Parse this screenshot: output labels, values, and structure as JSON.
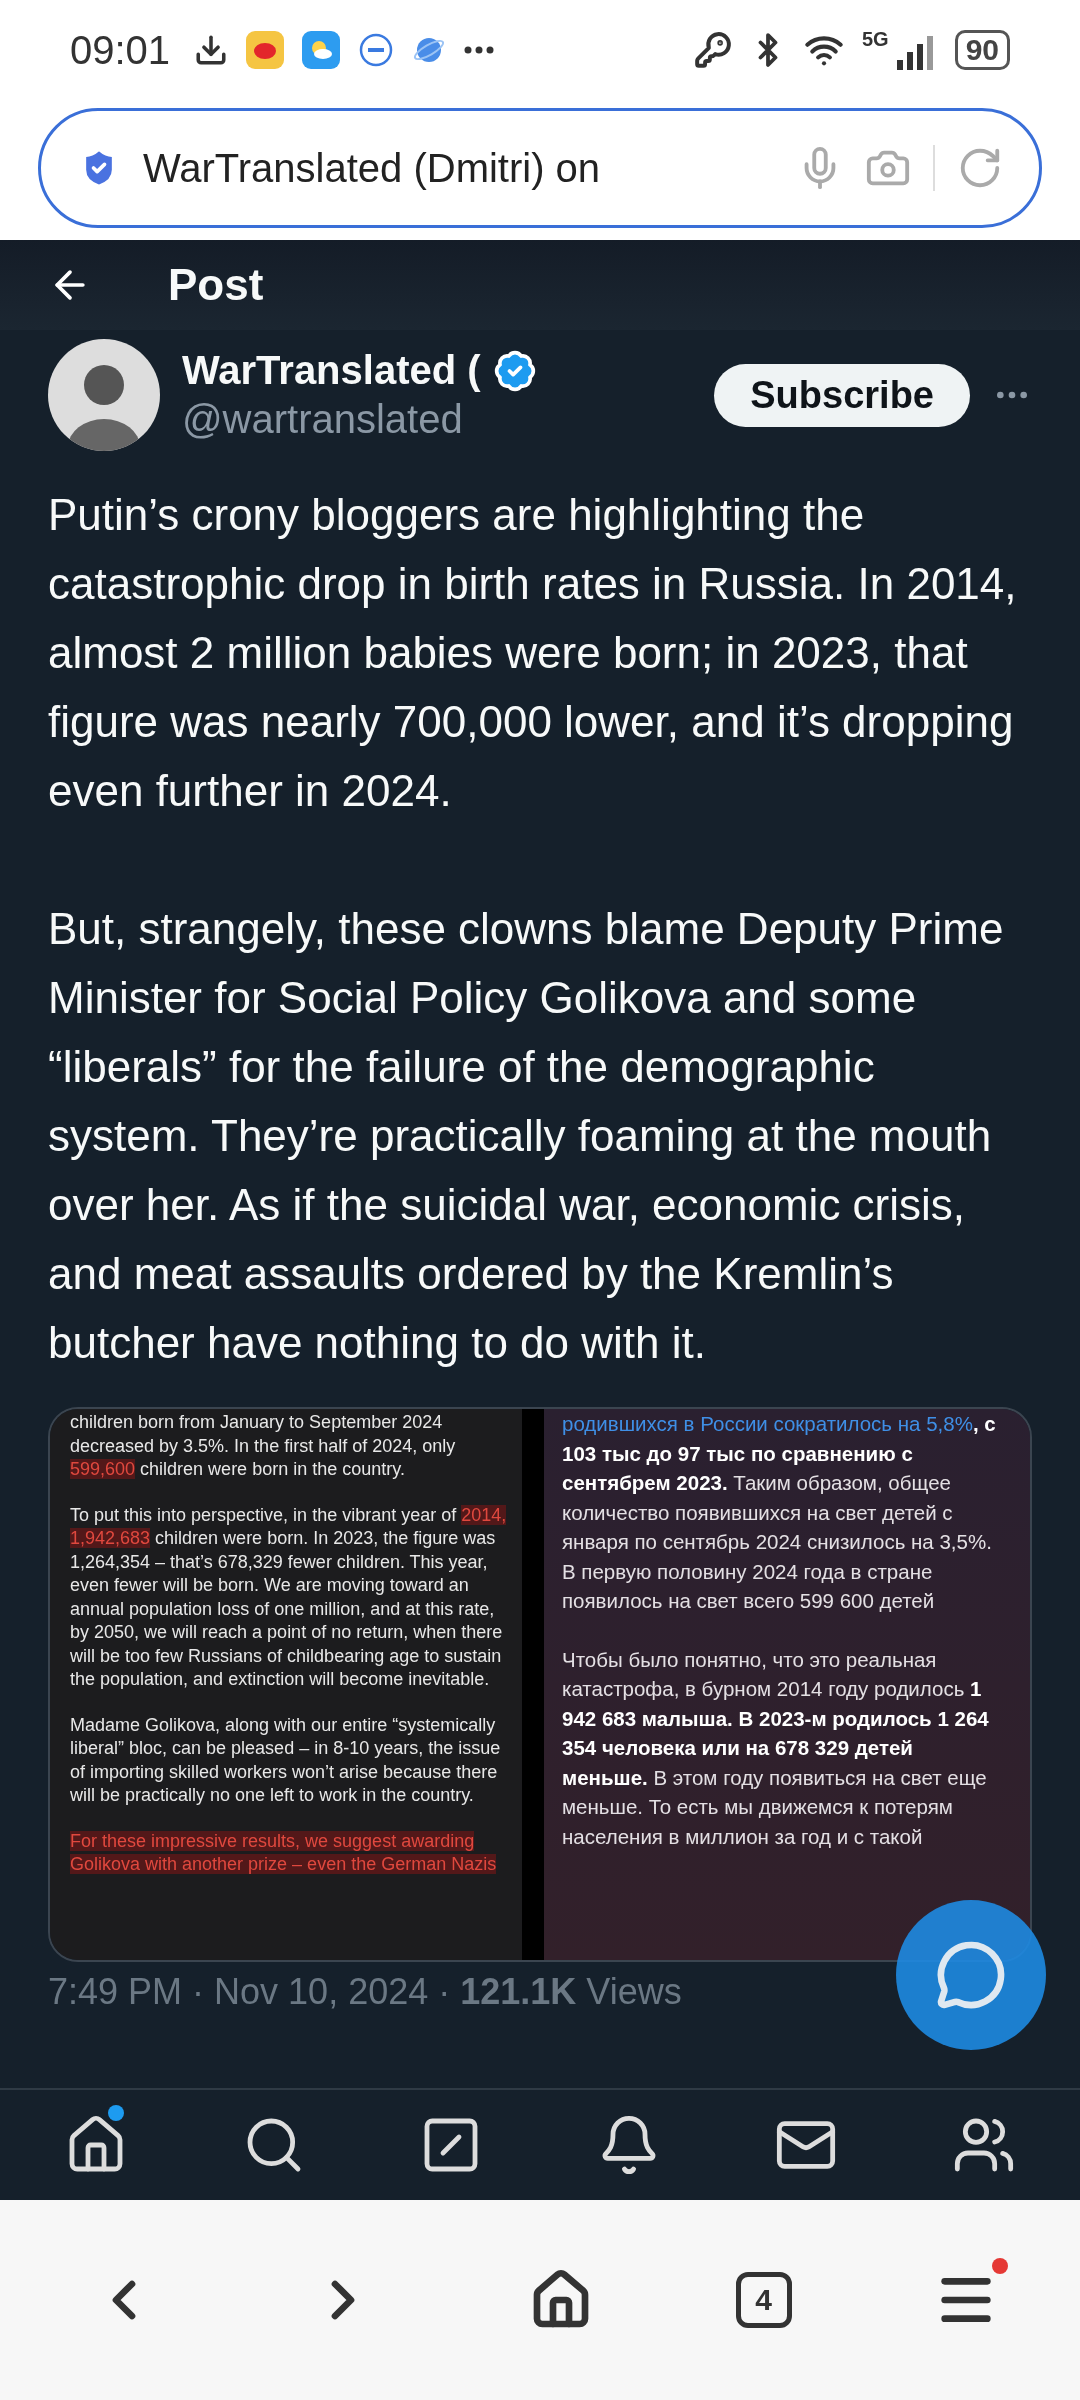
{
  "status_bar": {
    "time": "09:01",
    "network": "5G",
    "battery": "90"
  },
  "address_bar": {
    "value": "WarTranslated (Dmitri) on"
  },
  "header": {
    "title": "Post"
  },
  "author": {
    "name": "WarTranslated (",
    "handle": "@wartranslated",
    "verified": true,
    "subscribe_label": "Subscribe"
  },
  "post": {
    "paragraphs": [
      "Putin’s crony bloggers are highlighting the catastrophic drop in birth rates in Russia. In 2014, almost 2 million babies were born; in 2023, that figure was nearly 700,000 lower, and it’s dropping even further in 2024.",
      "But, strangely, these clowns blame Deputy Prime Minister for Social Policy Golikova and some “liberals” for the failure of the demographic system. They’re practically foaming at the mouth over her. As if the suicidal war, economic crisis, and meat assaults ordered by the Kremlin’s butcher have nothing to do with it."
    ]
  },
  "media": {
    "left_paragraphs": [
      [
        {
          "kind": "plain",
          "text": "children born from January to September 2024 decreased by 3.5%. In the first half of 2024, only "
        },
        {
          "kind": "red",
          "text": "599,600"
        },
        {
          "kind": "plain",
          "text": " children were born in the country."
        }
      ],
      [
        {
          "kind": "plain",
          "text": "To put this into perspective, in the vibrant year of "
        },
        {
          "kind": "red",
          "text": "2014, 1,942,683"
        },
        {
          "kind": "plain",
          "text": " children were born. In 2023, the figure was 1,264,354 – that’s 678,329 fewer children. This year, even fewer will be born. We are moving toward an annual population loss of one million, and at this rate, by 2050, we will reach a point of no return, when there will be too few Russians of childbearing age to sustain the population, and extinction will become inevitable."
        }
      ],
      [
        {
          "kind": "plain",
          "text": "Madame Golikova, along with our entire “systemically liberal” bloc, can be pleased – in 8-10 years, the issue of importing skilled workers won’t arise because there will be practically no one left to work in the country."
        }
      ],
      [
        {
          "kind": "red",
          "text": "For these impressive results, we suggest awarding Golikova with another prize – even the German Nazis"
        }
      ]
    ],
    "right_paragraphs": [
      [
        {
          "kind": "link",
          "text": "родившихся в России сократилось на 5,8%"
        },
        {
          "kind": "bold",
          "text": ", с 103 тыс до 97 тыс по сравнению с сентябрем 2023."
        },
        {
          "kind": "plain",
          "text": " Таким образом, общее количество появившихся на свет детей с января по сентябрь 2024 снизилось на 3,5%. В первую половину 2024 года в стране появилось на свет всего 599 600 детей"
        }
      ],
      [
        {
          "kind": "plain",
          "text": "Чтобы было понятно, что это реальная катастрофа, в бурном 2014 году родилось "
        },
        {
          "kind": "bold",
          "text": "1 942 683 малыша. В 2023-м родилось 1 264 354 человека или на 678 329 детей меньше."
        },
        {
          "kind": "plain",
          "text": " В этом году появиться на свет еще меньше. То есть мы движемся к потерям населения в миллион за год и с такой"
        }
      ]
    ]
  },
  "meta": {
    "text": "7:49 PM · Nov 10, 2024 · **121.1K** Views"
  },
  "bottom_nav": {
    "home_badge": true
  },
  "browser_bar": {
    "tab_count": "4",
    "menu_badge": true
  }
}
